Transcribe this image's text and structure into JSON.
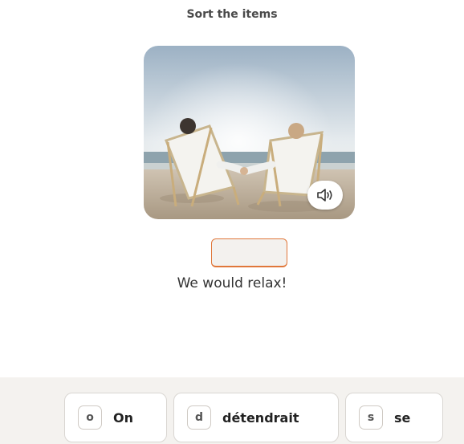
{
  "exercise": {
    "instruction": "Sort the items",
    "translation": "We would relax!",
    "image_icon": "speaker-icon"
  },
  "tiles": [
    {
      "key": "o",
      "word": "On"
    },
    {
      "key": "d",
      "word": "détendrait"
    },
    {
      "key": "s",
      "word": "se"
    }
  ],
  "colors": {
    "accent": "#e0773a",
    "tray": "#f4f2ef"
  }
}
